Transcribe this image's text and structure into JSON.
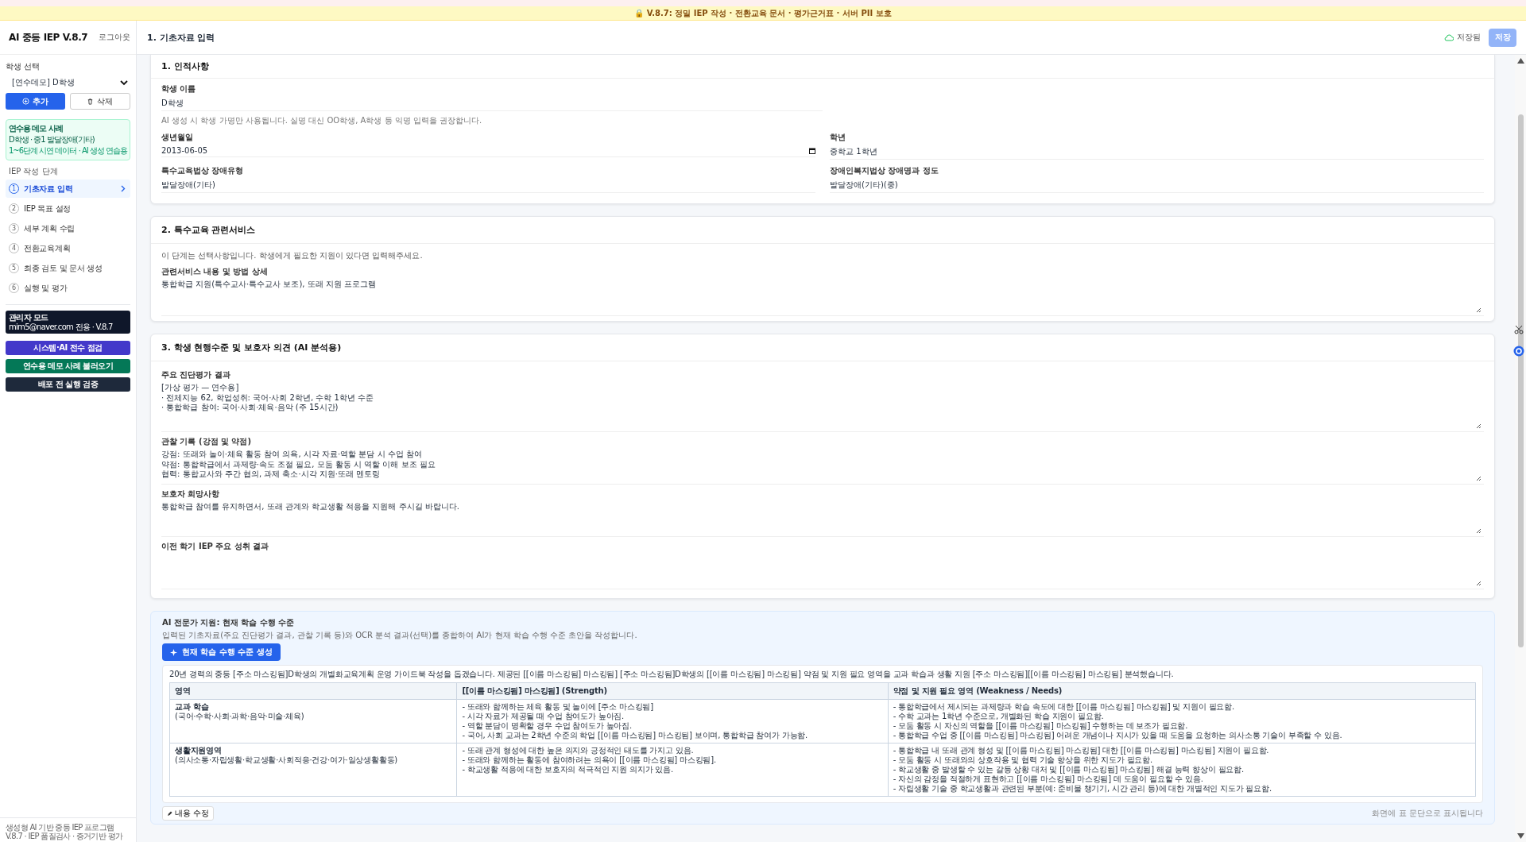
{
  "banner": {
    "text": "🔒 V.8.7: 정밀 IEP 작성 · 전환교육 문서 · 평가근거표 · 서버 PII 보호"
  },
  "sidebar": {
    "title": "AI 중등 IEP V.8.7",
    "logout": "로그아웃",
    "student_label": "학생 선택",
    "student_value": "[연수데모] D학생",
    "add_button": "추가",
    "delete_button": "삭제",
    "demo_card": {
      "title": "연수용 데모 사례",
      "line_1": "D학생 · 중1 발달장애(기타)",
      "line_2": "1~6단계 시연 데이터 · AI 생성 연습용"
    },
    "steps_label": "IEP 작성 단계",
    "steps": [
      {
        "number": "1",
        "label": "기초자료 입력",
        "selected": true
      },
      {
        "number": "2",
        "label": "IEP 목표 설정",
        "selected": false
      },
      {
        "number": "3",
        "label": "세부 계획 수립",
        "selected": false
      },
      {
        "number": "4",
        "label": "전환교육계획",
        "selected": false
      },
      {
        "number": "5",
        "label": "최종 검토 및 문서 생성",
        "selected": false
      },
      {
        "number": "6",
        "label": "실행 및 평가",
        "selected": false
      }
    ],
    "admin": {
      "title": "관리자 모드",
      "subtitle": "mim5@naver.com 전용 · V.8.7"
    },
    "admin_buttons": [
      {
        "label": "시스템·AI 전수 점검",
        "color": "#4338ca"
      },
      {
        "label": "연수용 데모 사례 불러오기",
        "color": "#047857"
      },
      {
        "label": "배포 전 실행 검증",
        "color": "#1e293b"
      }
    ],
    "footer_1": "생성형 AI 기반 중등 IEP 프로그램",
    "footer_2": "V.8.7 · IEP 품질검사 · 증거기반 평가"
  },
  "header": {
    "title": "1. 기초자료 입력",
    "saved": "저장됨",
    "save_button": "저장"
  },
  "section_1": {
    "title": "1. 인적사항",
    "name_label": "학생 이름",
    "name_value": "D학생",
    "note": "AI 생성 시 학생 가명만 사용됩니다. 실명 대신 OO학생, A학생 등 익명 입력을 권장합니다.",
    "fields": [
      {
        "label": "생년월일",
        "value": "2013-06-05",
        "kind": "date"
      },
      {
        "label": "학년",
        "value": "중학교 1학년",
        "kind": "text"
      },
      {
        "label": "특수교육법상 장애유형",
        "value": "발달장애(기타)",
        "kind": "text"
      },
      {
        "label": "장애인복지법상 장애명과 정도",
        "value": "발달장애(기타)(중)",
        "kind": "text"
      }
    ]
  },
  "section_2": {
    "title": "2. 특수교육 관련서비스",
    "note": "이 단계는 선택사항입니다. 학생에게 필요한 지원이 있다면 입력해주세요.",
    "label": "관련서비스 내용 및 방법 상세",
    "value": "통합학급 지원(특수교사·특수교사 보조), 또래 지원 프로그램"
  },
  "section_3": {
    "title": "3. 학생 현행수준 및 보호자 의견 (AI 분석용)",
    "fields": [
      {
        "label": "주요 진단평가 결과",
        "value": "[가상 평가 — 연수용]\n· 전체지능 62, 학업성취: 국어·사회 2학년, 수학 1학년 수준\n· 통합학급 참여: 국어·사회·체육·음악 (주 15시간)"
      },
      {
        "label": "관찰 기록 (강점 및 약점)",
        "value": "강점: 또래와 놀이·체육 활동 참여 의욕, 시각 자료·역할 분담 시 수업 참여\n약점: 통합학급에서 과제량·속도 조절 필요, 모둠 활동 시 역할 이해 보조 필요\n협력: 통합교사와 주간 협의, 과제 축소·시각 지원·또래 멘토링"
      },
      {
        "label": "보호자 희망사항",
        "value": "통합학급 참여를 유지하면서, 또래 관계와 학교생활 적응을 지원해 주시길 바랍니다."
      },
      {
        "label": "이전 학기 IEP 주요 성취 결과"
      }
    ]
  },
  "ai_panel": {
    "title": "AI 전문가 지원: 현재 학습 수행 수준",
    "description": "입력된 기초자료(주요 진단평가 결과, 관찰 기록 등)와 OCR 분석 결과(선택)를 종합하여 AI가 현재 학습 수행 수준 초안을 작성합니다.",
    "generate_button": "현재 학습 수행 수준 생성",
    "intro": "20년 경력의 중등 [주소 마스킹됨]D학생의 개별화교육계획 운영 가이드북 작성을 돕겠습니다. 제공된 [[이름 마스킹됨] 마스킹됨] [주소 마스킹됨]D학생의 [[이름 마스킹됨] 마스킹됨] 약점 및 지원 필요 영역을 교과 학습과 생활 지원 [주소 마스킹됨][[이름 마스킹됨] 마스킹됨] 분석했습니다.",
    "table": {
      "columns": [
        "영역",
        "[[이름 마스킹됨] 마스킹됨] (Strength)",
        "약점 및 지원 필요 영역 (Weakness / Needs)"
      ],
      "rows": [
        {
          "area": "교과 학습",
          "area_detail": "(국어·수학·사회·과학·음악·미술·체육)",
          "strengths": [
            "- 또래와 함께하는 체육 활동 및 놀이에 [주소 마스킹됨]",
            "- 시각 자료가 제공될 때 수업 참여도가 높아짐.",
            "- 역할 분담이 명확할 경우 수업 참여도가 높아짐.",
            "- 국어, 사회 교과는 2학년 수준의 학업 [[이름 마스킹됨] 마스킹됨] 보이며, 통합학급 참여가 가능함."
          ],
          "needs": [
            "- 통합학급에서 제시되는 과제량과 학습 속도에 대한 [[이름 마스킹됨] 마스킹됨] 및 지원이 필요함.",
            "- 수학 교과는 1학년 수준으로, 개별화된 학습 지원이 필요함.",
            "- 모둠 활동 시 자신의 역할을 [[이름 마스킹됨] 마스킹됨] 수행하는 데 보조가 필요함.",
            "- 통합학급 수업 중 [[이름 마스킹됨] 마스킹됨] 어려운 개념이나 지시가 있을 때 도움을 요청하는 의사소통 기술이 부족할 수 있음."
          ]
        },
        {
          "area": "생활지원영역",
          "area_detail": "(의사소통·자립생활·학교생활·사회적응·건강·여가·일상생활활동)",
          "strengths": [
            "- 또래 관계 형성에 대한 높은 의지와 긍정적인 태도를 가지고 있음.",
            "- 또래와 함께하는 활동에 참여하려는 의욕이 [[이름 마스킹됨] 마스킹됨].",
            "- 학교생활 적응에 대한 보호자의 적극적인 지원 의지가 있음."
          ],
          "needs": [
            "- 통합학급 내 또래 관계 형성 및 [[이름 마스킹됨] 마스킹됨] 대한 [[이름 마스킹됨] 마스킹됨] 지원이 필요함.",
            "- 모둠 활동 시 또래와의 상호작용 및 협력 기술 향상을 위한 지도가 필요함.",
            "- 학교생활 중 발생할 수 있는 갈등 상황 대처 및 [[이름 마스킹됨] 마스킹됨] 해결 능력 향상이 필요함.",
            "- 자신의 감정을 적절하게 표현하고 [[이름 마스킹됨] 마스킹됨] 데 도움이 필요할 수 있음.",
            "- 자립생활 기술 중 학교생활과 관련된 부분(예: 준비물 챙기기, 시간 관리 등)에 대한 개별적인 지도가 필요함."
          ]
        }
      ]
    },
    "edit_button": "내용 수정",
    "footnote": "화면에 표 문단으로 표시됩니다"
  }
}
